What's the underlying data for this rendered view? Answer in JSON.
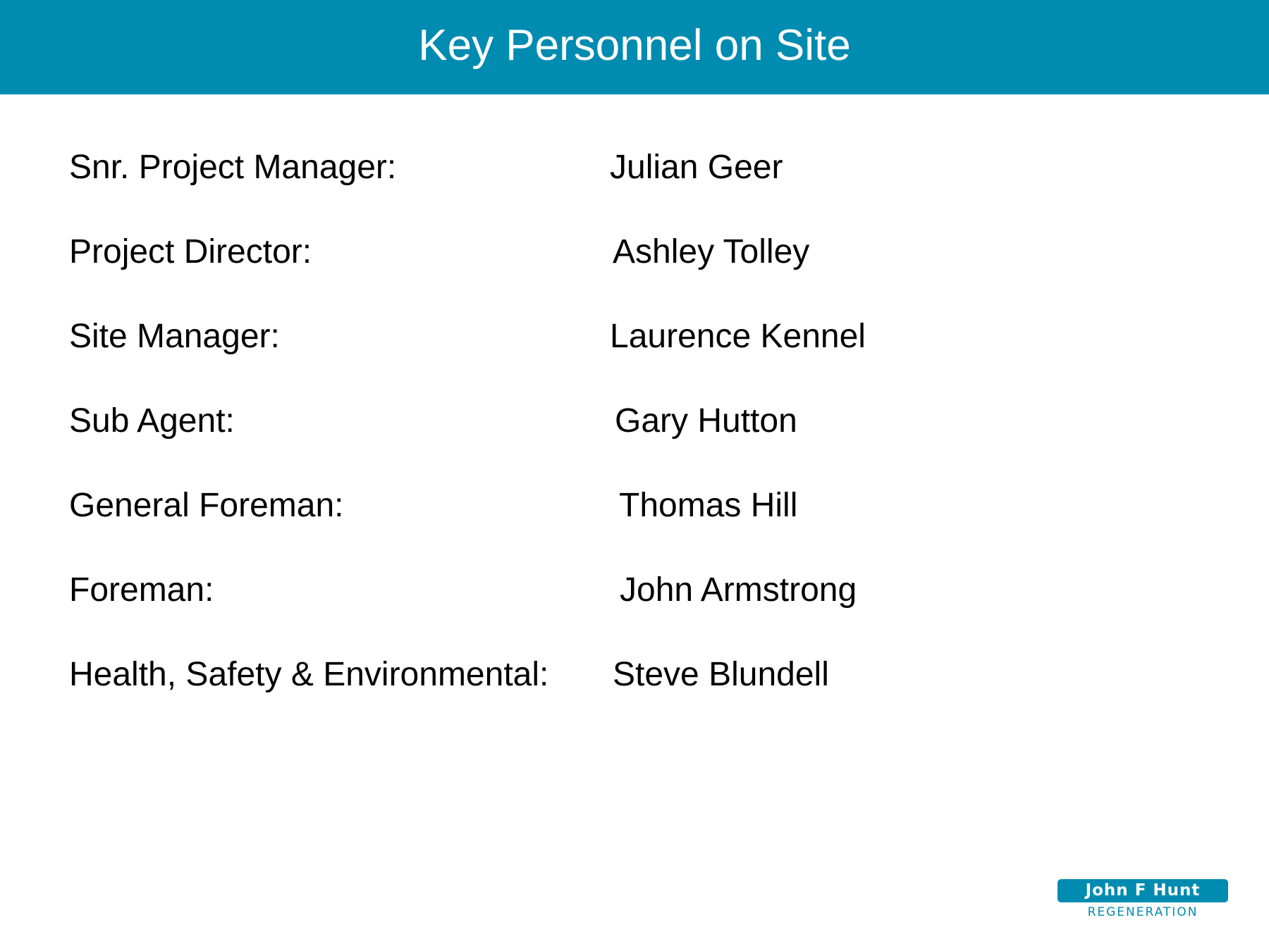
{
  "header": {
    "title": "Key Personnel on Site"
  },
  "personnel": [
    {
      "role": "Snr. Project Manager:",
      "name": "Julian Geer"
    },
    {
      "role": "Project Director:",
      "name": "Ashley Tolley"
    },
    {
      "role": "Site Manager:",
      "name": "Laurence Kennel"
    },
    {
      "role": "Sub Agent:",
      "name": "Gary Hutton"
    },
    {
      "role": "General Foreman:",
      "name": "Thomas Hill"
    },
    {
      "role": "Foreman:",
      "name": "John Armstrong"
    },
    {
      "role": "Health, Safety & Environmental:",
      "name": "Steve Blundell"
    }
  ],
  "logo": {
    "name": "John F Hunt",
    "subtitle": "REGENERATION"
  },
  "colors": {
    "brand": "#008bb0",
    "title_text": "#ffffff",
    "body_text": "#000000",
    "background": "#ffffff"
  }
}
